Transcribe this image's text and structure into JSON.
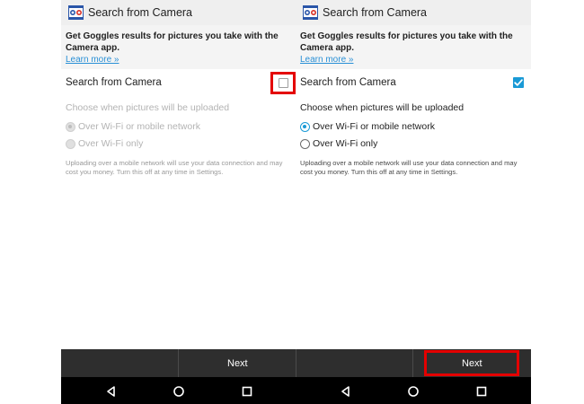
{
  "left": {
    "header": {
      "title": "Search from Camera",
      "logo_icon": "goggles-logo-icon"
    },
    "info": {
      "text": "Get Goggles results for pictures you take with the Camera app.",
      "learn_more": "Learn more »"
    },
    "setting": {
      "label": "Search from Camera",
      "checked": false
    },
    "upload": {
      "heading": "Choose when pictures will be uploaded",
      "enabled": false,
      "options": [
        {
          "label": "Over Wi-Fi or mobile network",
          "selected": true
        },
        {
          "label": "Over Wi-Fi only",
          "selected": false
        }
      ]
    },
    "fine_print": "Uploading over a mobile network will use your data connection and may cost you money. Turn this off at any time in Settings.",
    "next_label": "Next"
  },
  "right": {
    "header": {
      "title": "Search from Camera",
      "logo_icon": "goggles-logo-icon"
    },
    "info": {
      "text": "Get Goggles results for pictures you take with the Camera app.",
      "learn_more": "Learn more »"
    },
    "setting": {
      "label": "Search from Camera",
      "checked": true
    },
    "upload": {
      "heading": "Choose when pictures will be uploaded",
      "enabled": true,
      "options": [
        {
          "label": "Over Wi-Fi or mobile network",
          "selected": true
        },
        {
          "label": "Over Wi-Fi only",
          "selected": false
        }
      ]
    },
    "fine_print": "Uploading over a mobile network will use your data connection and may cost you money. Turn this off at any time in Settings.",
    "next_label": "Next"
  },
  "nav": {
    "icons": [
      "back-icon",
      "home-icon",
      "recents-icon"
    ]
  },
  "colors": {
    "accent": "#1a9ad6",
    "highlight": "#e40000",
    "bottom_bar": "#2e2e2e",
    "nav_bar": "#000000",
    "header_bg": "#efefef",
    "info_bg": "#f4f4f4"
  }
}
